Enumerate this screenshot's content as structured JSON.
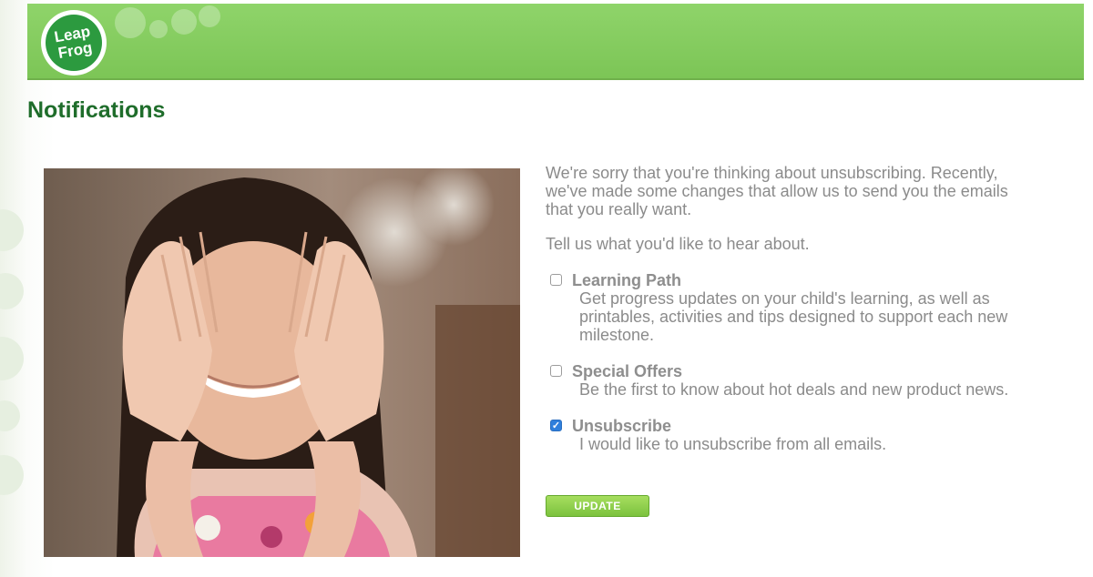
{
  "header": {
    "logo_text_line1": "Leap",
    "logo_text_line2": "Frog",
    "brand_color": "#7cc556"
  },
  "page": {
    "title": "Notifications"
  },
  "main": {
    "intro": "We're sorry that you're thinking about unsubscribing. Recently, we've made some changes that allow us to send you the emails that you really want.",
    "prompt": "Tell us what you'd like to hear about.",
    "options": [
      {
        "label": "Learning Path",
        "description": "Get progress updates on your child's learning, as well as printables, activities and tips designed to support each new milestone.",
        "checked": false
      },
      {
        "label": "Special Offers",
        "description": "Be the first to know about hot deals and new product news.",
        "checked": false
      },
      {
        "label": "Unsubscribe",
        "description": "I would like to unsubscribe from all emails.",
        "checked": true
      }
    ],
    "update_label": "UPDATE"
  },
  "colors": {
    "title": "#1f6d2b",
    "body_text": "#8b8b8b",
    "checkbox_checked": "#2f7fdc",
    "button": "#7cc23e"
  }
}
